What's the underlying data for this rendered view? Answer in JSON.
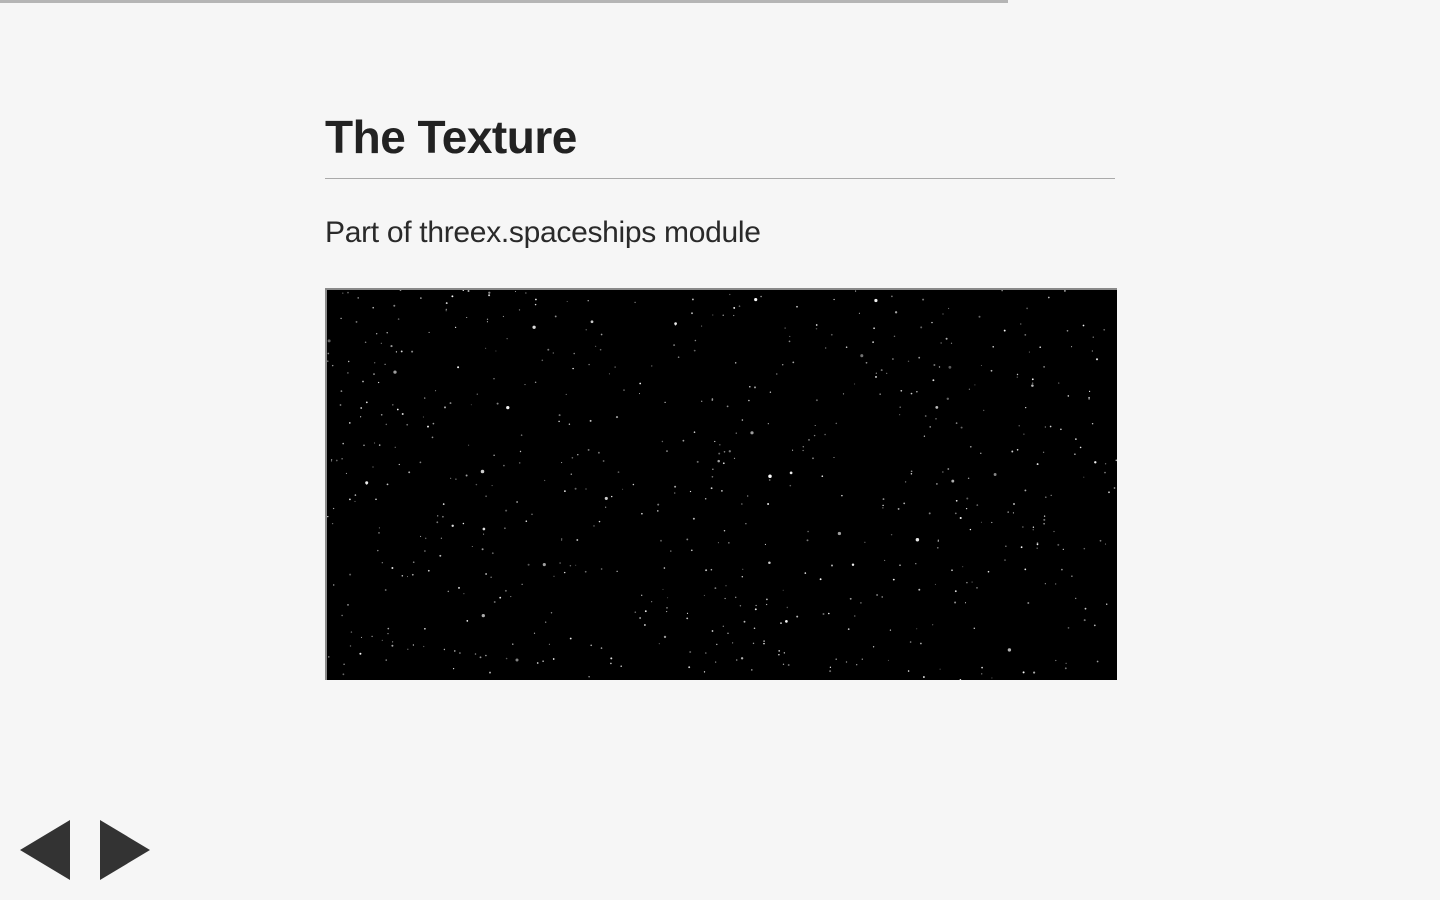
{
  "presentation": {
    "progress_fraction": 0.7,
    "progress_color": "#b5b5b5"
  },
  "slide": {
    "title": "The Texture",
    "text": "Part of threex.spaceships module",
    "image": {
      "icon": "starfield-image",
      "background": "#000000"
    }
  },
  "navigation": {
    "prev_icon": "triangle-left-icon",
    "next_icon": "triangle-right-icon",
    "color": "#333333"
  }
}
